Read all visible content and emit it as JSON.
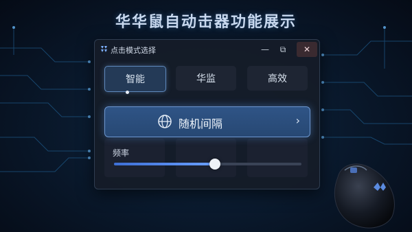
{
  "headline": "华华鼠自动击器功能展示",
  "window": {
    "title": "点击模式选择",
    "controls": {
      "minimize": "—",
      "maximize": "⧉",
      "close": "✕"
    }
  },
  "modes": [
    {
      "label": "智能",
      "active": true
    },
    {
      "label": "华监",
      "active": false
    },
    {
      "label": "高效",
      "active": false
    }
  ],
  "strategy": {
    "label": "随机间隔",
    "icon": "globe-icon",
    "chevron": "›"
  },
  "frequency": {
    "label": "频率",
    "value": 0.54
  },
  "colors": {
    "accent": "#5f89bd",
    "background": "#0a1a2e",
    "slider_fill": "#4a80e8"
  }
}
